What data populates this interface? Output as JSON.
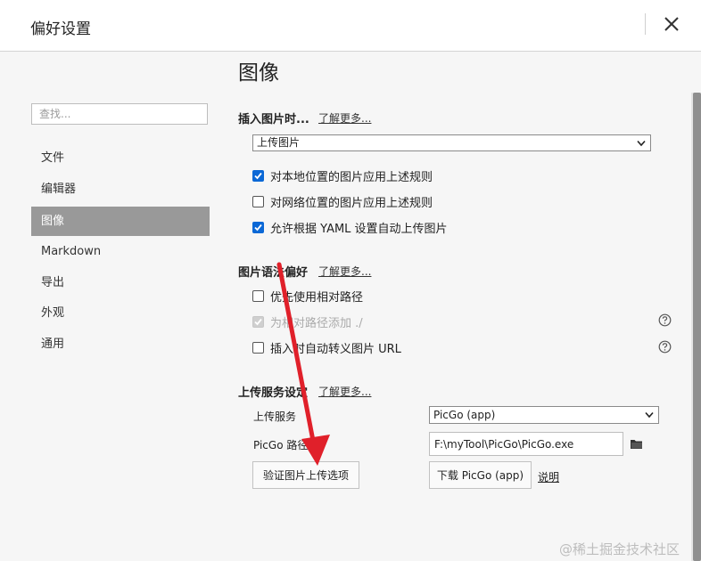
{
  "window": {
    "title": "偏好设置"
  },
  "search": {
    "placeholder": "查找..."
  },
  "sidebar": {
    "items": [
      {
        "label": "文件"
      },
      {
        "label": "编辑器"
      },
      {
        "label": "图像",
        "active": true
      },
      {
        "label": "Markdown"
      },
      {
        "label": "导出"
      },
      {
        "label": "外观"
      },
      {
        "label": "通用"
      }
    ]
  },
  "main": {
    "title": "图像",
    "insert_section": {
      "title": "插入图片时...",
      "learn_more": "了解更多...",
      "action_select": "上传图片",
      "options": [
        {
          "label": "对本地位置的图片应用上述规则",
          "checked": true
        },
        {
          "label": "对网络位置的图片应用上述规则",
          "checked": false
        },
        {
          "label": "允许根据 YAML 设置自动上传图片",
          "checked": true
        }
      ]
    },
    "syntax_section": {
      "title": "图片语法偏好",
      "learn_more": "了解更多...",
      "options": [
        {
          "label": "优先使用相对路径",
          "checked": false,
          "disabled": false
        },
        {
          "label": "为相对路径添加 ./",
          "checked": true,
          "disabled": true
        },
        {
          "label": "插入时自动转义图片 URL",
          "checked": false,
          "disabled": false
        }
      ]
    },
    "upload_section": {
      "title": "上传服务设定",
      "learn_more": "了解更多...",
      "service_label": "上传服务",
      "service_value": "PicGo (app)",
      "path_label": "PicGo 路径",
      "path_value": "F:\\myTool\\PicGo\\PicGo.exe",
      "verify_button": "验证图片上传选项",
      "download_button": "下载 PicGo (app)",
      "explain_link": "说明"
    }
  },
  "watermark": "@稀土掘金技术社区",
  "colors": {
    "accent": "#0b68d6",
    "annotation_arrow": "#e0202a",
    "sidebar_active": "#999999"
  }
}
